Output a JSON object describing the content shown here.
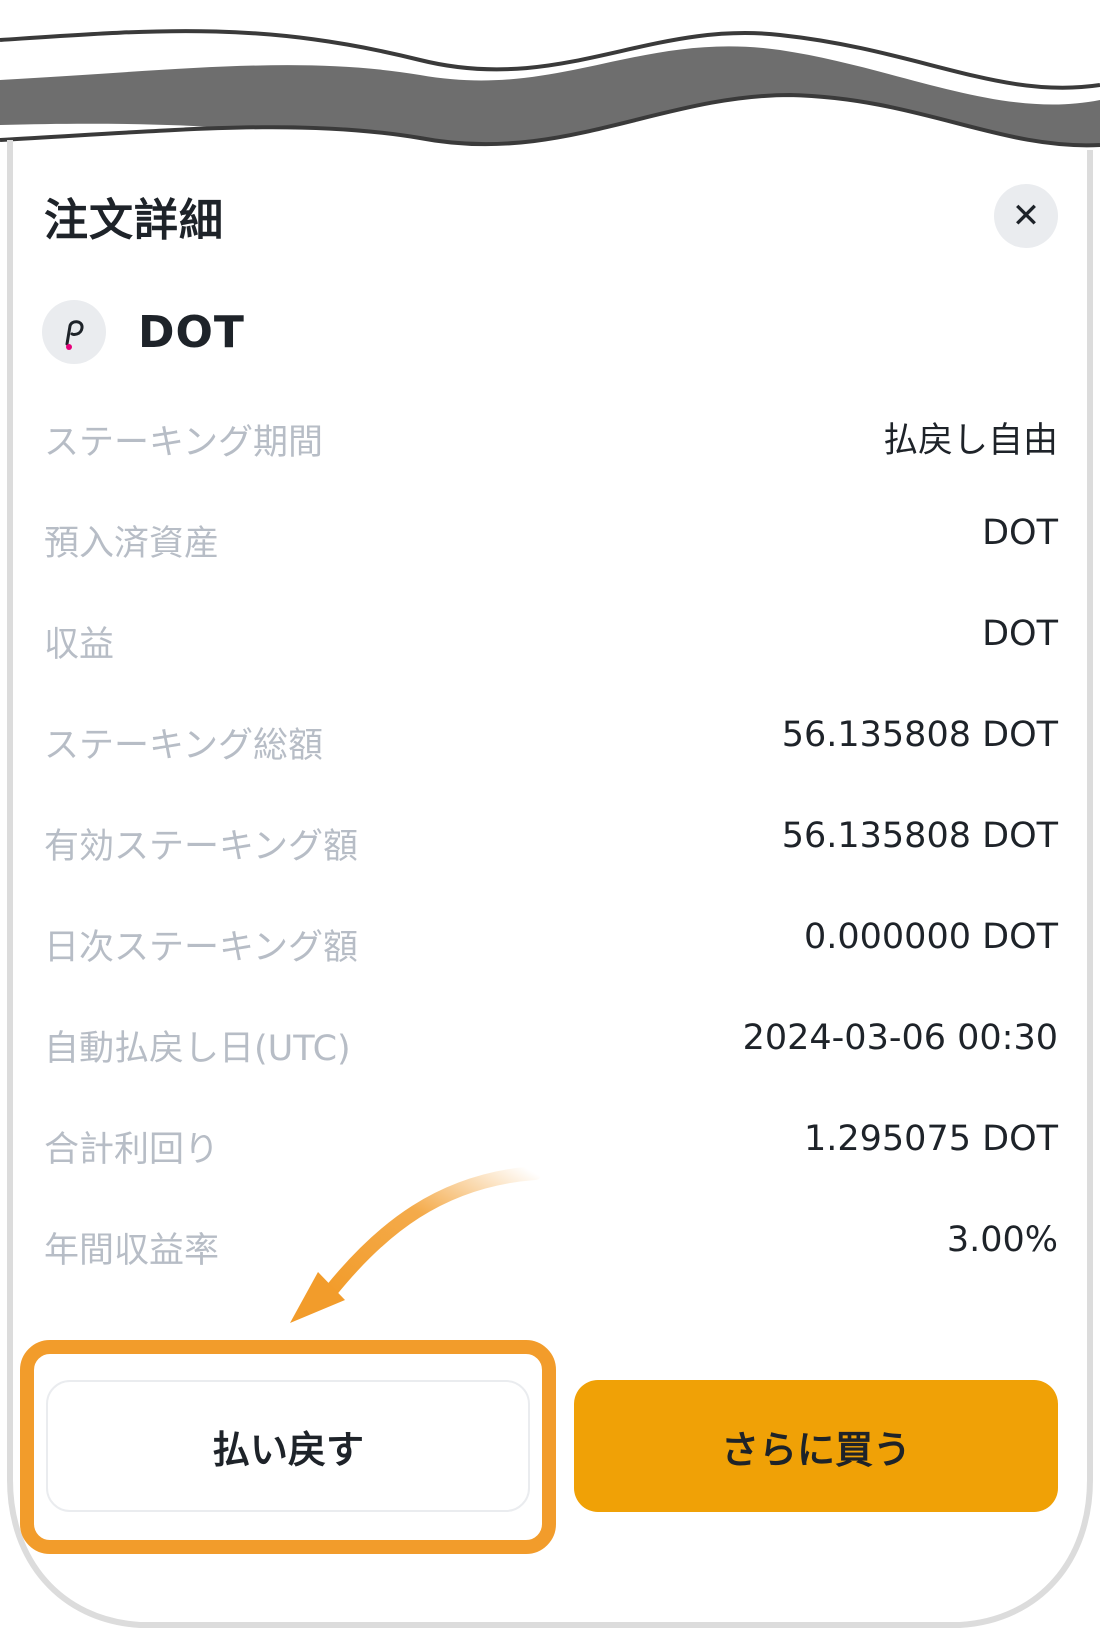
{
  "header": {
    "title": "注文詳細",
    "close_icon": "close-icon"
  },
  "asset": {
    "name": "DOT",
    "icon": "polkadot-icon",
    "icon_accent": "#e6007a"
  },
  "details": [
    {
      "label": "ステーキング期間",
      "value": "払戻し自由"
    },
    {
      "label": "預入済資産",
      "value": "DOT"
    },
    {
      "label": "収益",
      "value": "DOT"
    },
    {
      "label": "ステーキング総額",
      "value": "56.135808 DOT"
    },
    {
      "label": "有効ステーキング額",
      "value": "56.135808 DOT"
    },
    {
      "label": "日次ステーキング額",
      "value": "0.000000 DOT"
    },
    {
      "label": "自動払戻し日(UTC)",
      "value": "2024-03-06 00:30"
    },
    {
      "label": "合計利回り",
      "value": "1.295075 DOT"
    },
    {
      "label": "年間収益率",
      "value": "3.00%"
    }
  ],
  "actions": {
    "redeem_label": "払い戻す",
    "buy_more_label": "さらに買う"
  },
  "colors": {
    "accent": "#f0a106",
    "highlight": "#f29c2b",
    "label_gray": "#b7bdc6",
    "text_dark": "#1e2329"
  }
}
